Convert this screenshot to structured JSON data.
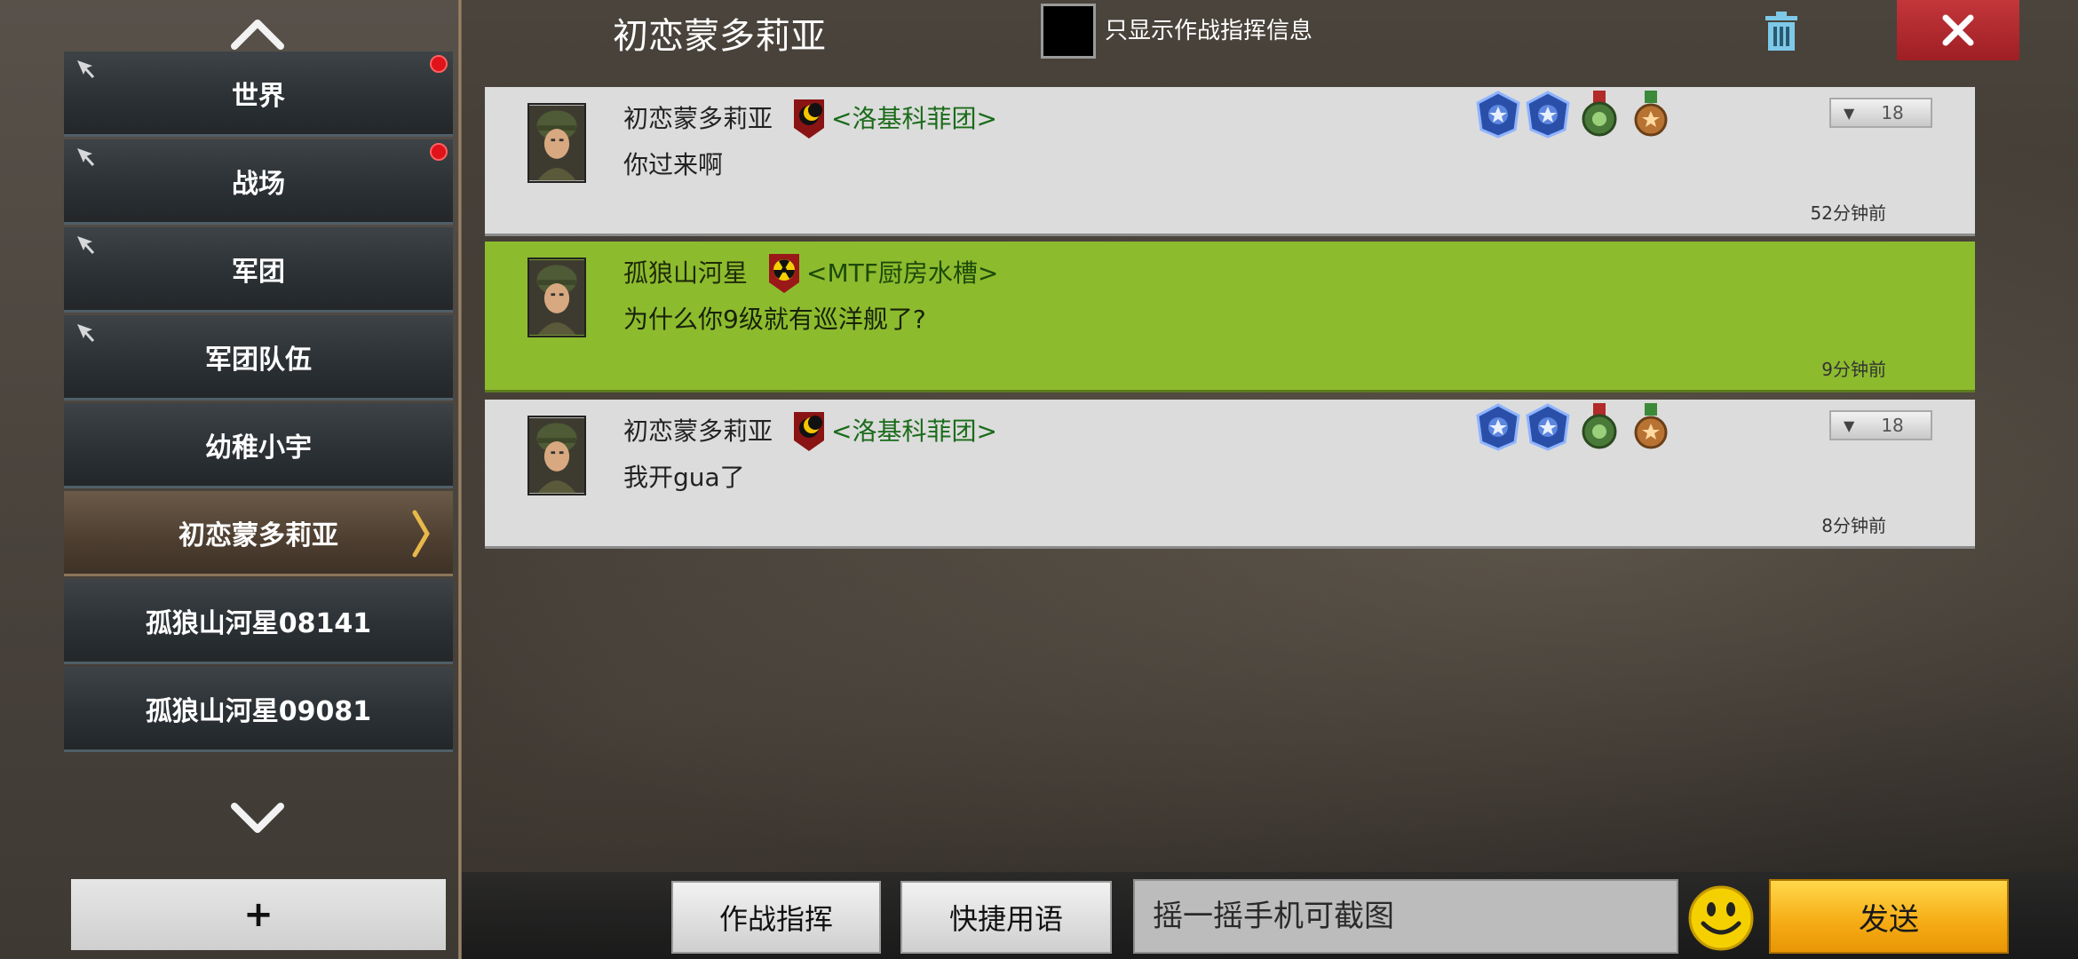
{
  "sidebar": {
    "channels": [
      {
        "label": "世界",
        "pinned": true,
        "unread": true,
        "active": false
      },
      {
        "label": "战场",
        "pinned": true,
        "unread": true,
        "active": false
      },
      {
        "label": "军团",
        "pinned": true,
        "unread": false,
        "active": false
      },
      {
        "label": "军团队伍",
        "pinned": true,
        "unread": false,
        "active": false
      },
      {
        "label": "幼稚小宇",
        "pinned": false,
        "unread": false,
        "active": false
      },
      {
        "label": "初恋蒙多莉亚",
        "pinned": false,
        "unread": false,
        "active": true
      },
      {
        "label": "孤狼山河星08141",
        "pinned": false,
        "unread": false,
        "active": false
      },
      {
        "label": "孤狼山河星09081",
        "pinned": false,
        "unread": false,
        "active": false
      }
    ],
    "add_label": "+",
    "unread_dot_color": "#e0121a"
  },
  "header": {
    "title": "初恋蒙多莉亚",
    "filter_label": "只显示作战指挥信息",
    "filter_checked": false
  },
  "messages": [
    {
      "sender": "初恋蒙多莉亚",
      "legion_emblem": "moon-emblem",
      "legion": "<洛基科菲团>",
      "text": "你过来啊",
      "time": "52分钟前",
      "highlight": false,
      "medals": [
        "blue-star-medal",
        "blue-star-medal",
        "green-gear-medal",
        "bronze-star-medal"
      ],
      "level": "18"
    },
    {
      "sender": "孤狼山河星",
      "legion_emblem": "radiation-emblem",
      "legion": "<MTF厨房水槽>",
      "text": "为什么你9级就有巡洋舰了?",
      "time": "9分钟前",
      "highlight": true,
      "medals": [],
      "level": ""
    },
    {
      "sender": "初恋蒙多莉亚",
      "legion_emblem": "moon-emblem",
      "legion": "<洛基科菲团>",
      "text": "我开gua了",
      "time": "8分钟前",
      "highlight": false,
      "medals": [
        "blue-star-medal",
        "blue-star-medal",
        "green-gear-medal",
        "bronze-star-medal"
      ],
      "level": "18"
    }
  ],
  "bottom": {
    "battle_cmd_label": "作战指挥",
    "quick_phrase_label": "快捷用语",
    "input_placeholder": "摇一摇手机可截图",
    "send_label": "发送"
  },
  "colors": {
    "highlight_bg": "#8dbb2e",
    "message_bg": "#dcdcdc",
    "send_button": "#f5ab14",
    "close_button": "#b8292e",
    "legion_text": "#1a6b1a"
  }
}
